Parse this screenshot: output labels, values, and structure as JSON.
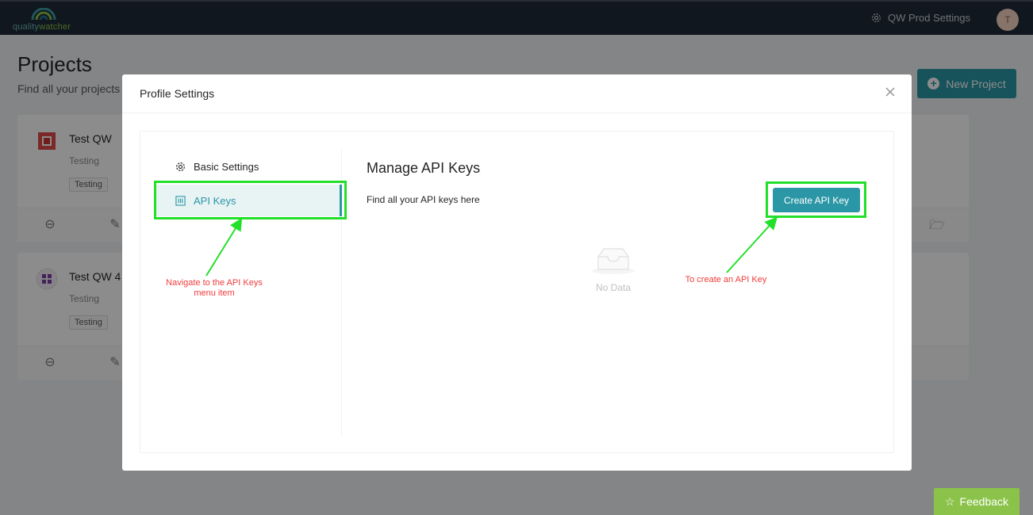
{
  "header": {
    "logo_prefix": "quality",
    "logo_suffix": "watcher",
    "settings_label": "QW Prod Settings",
    "avatar_initial": "T"
  },
  "page": {
    "title": "Projects",
    "subtitle": "Find all your projects",
    "new_project_label": "New Project"
  },
  "projects": [
    {
      "name": "Test QW",
      "description": "Testing",
      "tag": "Testing"
    },
    {
      "name": "Test QW 4",
      "description": "Testing",
      "tag": "Testing"
    }
  ],
  "modal": {
    "title": "Profile Settings",
    "menu": [
      {
        "label": "Basic Settings",
        "icon": "gear-icon"
      },
      {
        "label": "API Keys",
        "icon": "api-key-icon",
        "active": true
      }
    ],
    "content_title": "Manage API Keys",
    "content_subtitle": "Find all your API keys here",
    "create_button_label": "Create API Key",
    "empty_text": "No Data"
  },
  "annotations": {
    "menu_note": "Navigate to the API Keys menu item",
    "button_note": "To create an API Key"
  },
  "feedback_label": "Feedback",
  "colors": {
    "accent": "#2b97a6",
    "topbar": "#1e2a38",
    "highlight": "#22e02a",
    "annotation_text": "#f03c3c",
    "feedback": "#8bc34a"
  }
}
